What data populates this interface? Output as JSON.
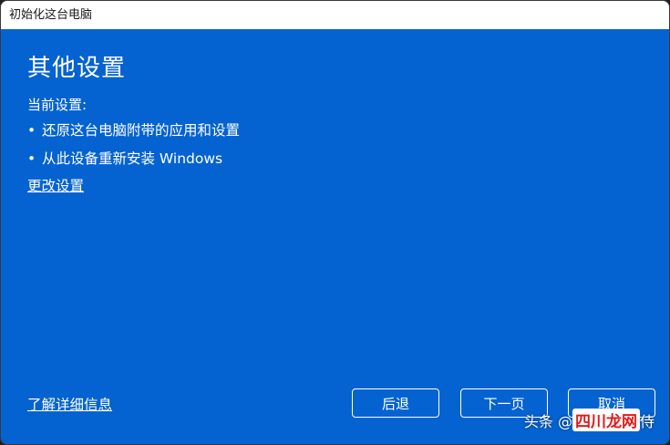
{
  "window": {
    "title": "初始化这台电脑"
  },
  "main": {
    "heading": "其他设置",
    "current_settings_label": "当前设置:",
    "bullets": [
      "还原这台电脑附带的应用和设置",
      "从此设备重新安装 Windows"
    ],
    "change_link": "更改设置",
    "learn_more_link": "了解详细信息"
  },
  "buttons": {
    "back": "后退",
    "next": "下一页",
    "cancel": "取消"
  },
  "watermark": {
    "prefix": "头条 @",
    "badge": "四川龙网",
    "suffix": "侍"
  },
  "colors": {
    "background": "#0563d1",
    "titlebar": "#ffffff",
    "text": "#ffffff"
  }
}
